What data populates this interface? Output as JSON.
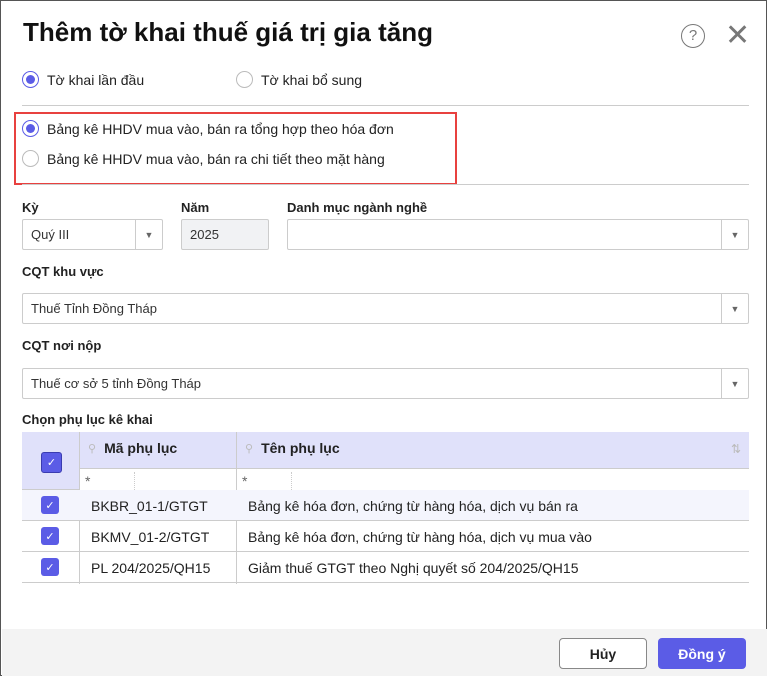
{
  "title": "Thêm tờ khai thuế giá trị gia tăng",
  "declaration_type": [
    {
      "label": "Tờ khai lần đầu",
      "selected": true
    },
    {
      "label": "Tờ khai bổ sung",
      "selected": false
    }
  ],
  "list_type": [
    {
      "label": "Bảng kê HHDV mua vào, bán ra tổng hợp theo hóa đơn",
      "selected": true
    },
    {
      "label": "Bảng kê HHDV mua vào, bán ra chi tiết theo mặt hàng",
      "selected": false
    }
  ],
  "period": {
    "label": "Kỳ",
    "value": "Quý III"
  },
  "year": {
    "label": "Năm",
    "value": "2025"
  },
  "industry": {
    "label": "Danh mục ngành nghề",
    "value": ""
  },
  "tax_area": {
    "label": "CQT khu vực",
    "value": "Thuế Tỉnh Đồng Tháp"
  },
  "tax_office": {
    "label": "CQT nơi nộp",
    "value": "Thuế cơ sở 5 tỉnh Đồng Tháp"
  },
  "appendix": {
    "label": "Chọn phụ lục kê khai",
    "columns": [
      "Mã phụ lục",
      "Tên phụ lục"
    ],
    "filter": [
      "*",
      "*"
    ],
    "rows": [
      {
        "code": "BKBR_01-1/GTGT",
        "name": "Bảng kê hóa đơn, chứng từ hàng hóa, dịch vụ bán ra",
        "checked": true
      },
      {
        "code": "BKMV_01-2/GTGT",
        "name": "Bảng kê hóa đơn, chứng từ hàng hóa, dịch vụ mua vào",
        "checked": true
      },
      {
        "code": "PL 204/2025/QH15",
        "name": "Giảm thuế GTGT theo Nghị quyết số 204/2025/QH15",
        "checked": true
      }
    ]
  },
  "buttons": {
    "cancel": "Hủy",
    "ok": "Đồng ý"
  },
  "colors": {
    "accent": "#5b5ce6",
    "highlight": "#e8413f"
  }
}
